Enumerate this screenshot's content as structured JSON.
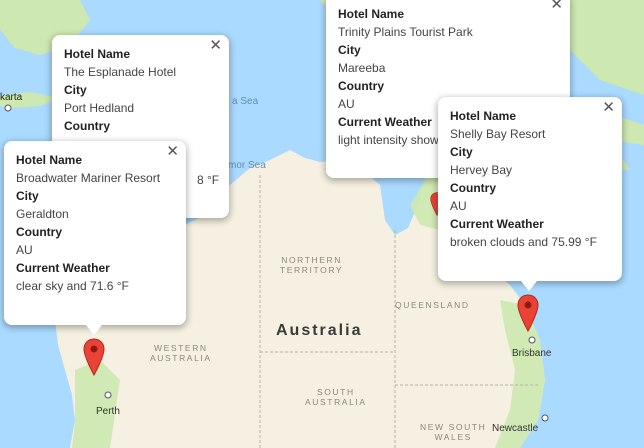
{
  "map": {
    "country_label": "Australia",
    "state_labels": {
      "nt": [
        "NORTHERN",
        "TERRITORY"
      ],
      "wa": [
        "WESTERN",
        "AUSTRALIA"
      ],
      "qld": "QUEENSLAND",
      "sa": [
        "SOUTH",
        "AUSTRALIA"
      ],
      "nsw": [
        "NEW SOUTH",
        "WALES"
      ]
    },
    "sea_labels": {
      "java_sea": "a Sea",
      "timor_sea": "mor Sea"
    },
    "city_labels": {
      "jakarta": "karta",
      "perth": "Perth",
      "brisbane": "Brisbane",
      "newcastle": "Newcastle"
    },
    "colors": {
      "water": "#aadaff",
      "land": "#f5f0e1",
      "forest": "#cde8b0",
      "pin": "#ea4335"
    }
  },
  "info_windows": [
    {
      "id": "trinity",
      "hotel_name_label": "Hotel Name",
      "hotel_name": "Trinity Plains Tourist Park",
      "city_label": "City",
      "city": "Mareeba",
      "country_label": "Country",
      "country": "AU",
      "weather_label": "Current Weather",
      "weather": "light intensity show"
    },
    {
      "id": "esplanade",
      "hotel_name_label": "Hotel Name",
      "hotel_name": "The Esplanade Hotel",
      "city_label": "City",
      "city": "Port Hedland",
      "country_label": "Country",
      "country": "",
      "weather_label": "",
      "weather": "8 °F"
    },
    {
      "id": "shelly",
      "hotel_name_label": "Hotel Name",
      "hotel_name": "Shelly Bay Resort",
      "city_label": "City",
      "city": "Hervey Bay",
      "country_label": "Country",
      "country": "AU",
      "weather_label": "Current Weather",
      "weather": "broken clouds and 75.99 °F"
    },
    {
      "id": "broadwater",
      "hotel_name_label": "Hotel Name",
      "hotel_name": "Broadwater Mariner Resort",
      "city_label": "City",
      "city": "Geraldton",
      "country_label": "Country",
      "country": "AU",
      "weather_label": "Current Weather",
      "weather": "clear sky and 71.6 °F"
    }
  ],
  "close_glyph": "✕"
}
